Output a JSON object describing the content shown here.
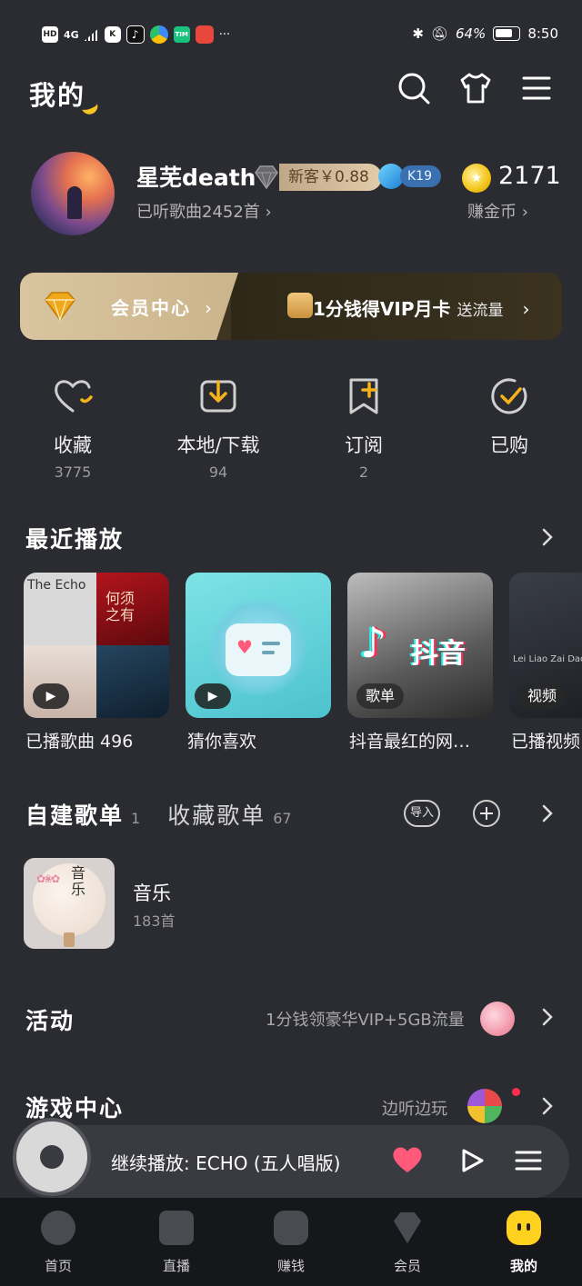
{
  "status_bar": {
    "left_badges": [
      "HD",
      "4G",
      "K",
      "TIM"
    ],
    "more_label": "···",
    "battery": "64%",
    "time": "8:50"
  },
  "header": {
    "title": "我的"
  },
  "profile": {
    "username": "星芜death",
    "newcomer_badge": "新客￥0.88",
    "level_badge": "K19",
    "listened": "已听歌曲2452首",
    "coins": "2171",
    "earn_coins": "赚金币"
  },
  "vip_banner": {
    "center_label": "会员中心",
    "offer_main": "1分钱得VIP月卡",
    "offer_extra": "送流量"
  },
  "shortcuts": [
    {
      "label": "收藏",
      "count": "3775"
    },
    {
      "label": "本地/下载",
      "count": "94"
    },
    {
      "label": "订阅",
      "count": "2"
    },
    {
      "label": "已购",
      "count": ""
    }
  ],
  "recent": {
    "title": "最近播放",
    "cards": [
      {
        "label": "已播歌曲 496",
        "tag": ""
      },
      {
        "label": "猜你喜欢",
        "tag": ""
      },
      {
        "label": "抖音最红的网…",
        "tag": "歌单"
      },
      {
        "label": "已播视频",
        "tag": "视频"
      }
    ],
    "cover_texts": {
      "echo": "The Echo",
      "song2": "何须之有",
      "douyin": "抖音",
      "video": "Lei Liao Zai  DaoLang"
    }
  },
  "playlists": {
    "tab_own": "自建歌单",
    "tab_own_count": "1",
    "tab_fav": "收藏歌单",
    "tab_fav_count": "67",
    "import_label": "导入",
    "items": [
      {
        "title": "音乐",
        "count": "183首",
        "cover_text": "音乐"
      }
    ]
  },
  "activity": {
    "title": "活动",
    "hint": "1分钱领豪华VIP+5GB流量"
  },
  "game": {
    "title": "游戏中心",
    "hint": "边听边玩"
  },
  "mini_player": {
    "text": "继续播放:  ECHO (五人唱版)"
  },
  "bottom_nav": [
    {
      "label": "首页"
    },
    {
      "label": "直播"
    },
    {
      "label": "赚钱"
    },
    {
      "label": "会员"
    },
    {
      "label": "我的"
    }
  ],
  "colors": {
    "background": "#2b2c31",
    "accent": "#ffd21f",
    "like": "#ff5a7a",
    "vip_gold": "#d8c5a0"
  }
}
